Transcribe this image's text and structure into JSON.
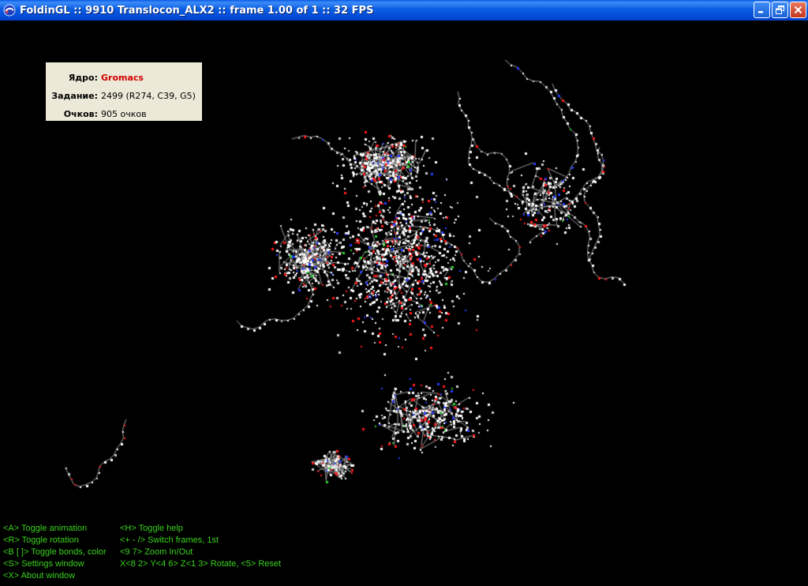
{
  "window": {
    "title": "FoldinGL :: 9910 Translocon_ALX2 :: frame 1.00 of 1 :: 32 FPS",
    "icon": "foldingl-app-icon",
    "buttons": [
      "minimize-icon",
      "maximize-icon",
      "close-icon"
    ]
  },
  "info_panel": {
    "core_label": "Ядро:",
    "core_value": "Gromacs",
    "task_label": "Задание:",
    "task_value": "2499 (R274, C39, G5)",
    "points_label": "Очков:",
    "points_value": "905 очков"
  },
  "help": {
    "left": [
      "<A> Toggle animation",
      "<R> Toggle rotation",
      "<B [ ]> Toggle bonds, color",
      "<S> Settings window",
      "<X> About window"
    ],
    "right": [
      "<H> Toggle help",
      "<+ - /> Switch frames, 1st",
      "<9 7> Zoom In/Out",
      "X<8 2> Y<4 6> Z<1 3> Rotate, <5> Reset"
    ]
  },
  "colors": {
    "background": "#000000",
    "bond": "#9a9a9a",
    "atom_white": "#ffffff",
    "atom_red": "#ff1a1a",
    "atom_blue": "#2a3cff",
    "atom_green": "#2bd12b",
    "help_text": "#39d31c",
    "panel_bg": "#ece9d8",
    "core_value": "#d20000"
  }
}
